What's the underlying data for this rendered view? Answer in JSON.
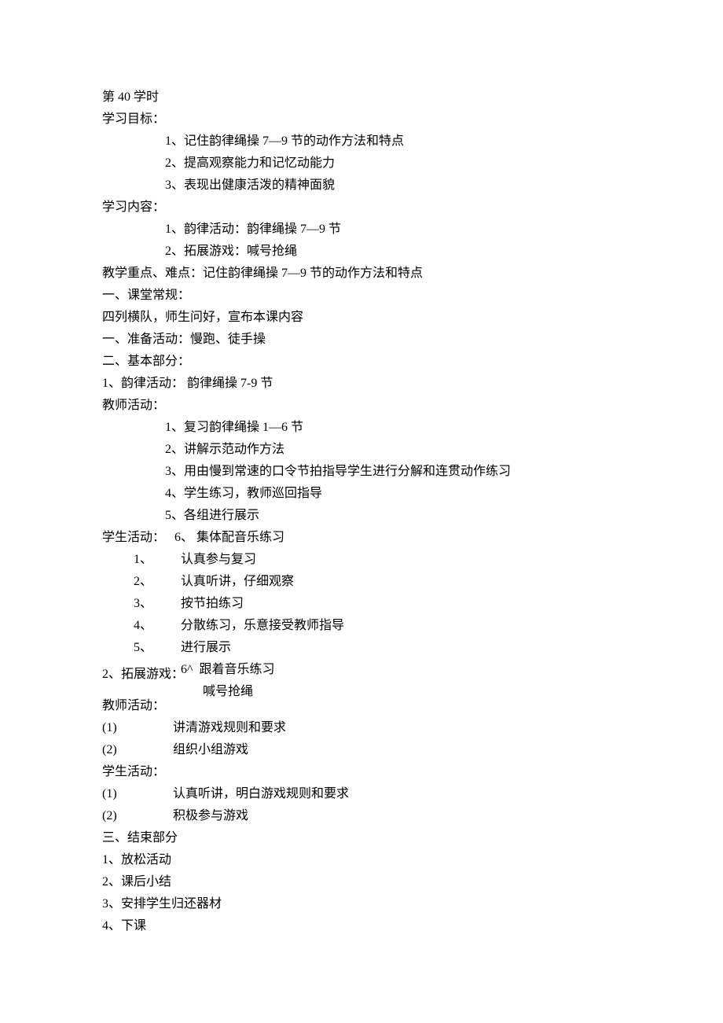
{
  "lesson": {
    "title": "第 40 学时",
    "objectives": {
      "heading": "学习目标：",
      "items": [
        "1、记住韵律绳操 7—9 节的动作方法和特点",
        "2、提高观察能力和记忆动能力",
        "3、表现出健康活泼的精神面貌"
      ]
    },
    "content": {
      "heading": "学习内容：",
      "items": [
        "1、韵律活动：韵律绳操 7—9 节",
        "2、拓展游戏：喊号抢绳"
      ]
    },
    "key_point": "教学重点、难点：记住韵律绳操 7—9 节的动作方法和特点",
    "routine": {
      "heading": "一、课堂常规：",
      "line": "四列横队，师生问好，宣布本课内容"
    },
    "prep": "一、准备活动：慢跑、徒手操",
    "main": {
      "heading": "二、基本部分：",
      "section1": {
        "title": "1、韵律活动： 韵律绳操 7-9 节",
        "teacher": {
          "heading": "教师活动：",
          "items": [
            "1、复习韵律绳操 1—6 节",
            "2、讲解示范动作方法",
            "3、用由慢到常速的口令节拍指导学生进行分解和连贯动作练习",
            "4、学生练习，教师巡回指导",
            "5、各组进行展示"
          ]
        },
        "student": {
          "heading_left": "学生活动：",
          "six_num": "6、",
          "six_text": "集体配音乐练习",
          "items": [
            {
              "num": "1、",
              "text": "认真参与复习"
            },
            {
              "num": "2、",
              "text": "认真听讲，仔细观察"
            },
            {
              "num": "3、",
              "text": "按节拍练习"
            },
            {
              "num": "4、",
              "text": "分散练习，乐意接受教师指导"
            },
            {
              "num": "5、",
              "text": "进行展示"
            }
          ]
        },
        "game": {
          "label": "2、拓展游戏：",
          "six_num": "6^",
          "six_text": "跟着音乐练习",
          "name": "喊号抢绳"
        },
        "teacher2": {
          "heading": "教师活动：",
          "items": [
            {
              "num": "(1)",
              "text": "讲清游戏规则和要求"
            },
            {
              "num": "(2)",
              "text": "组织小组游戏"
            }
          ]
        },
        "student2": {
          "heading": "学生活动：",
          "items": [
            {
              "num": "(1)",
              "text": "认真听讲，明白游戏规则和要求"
            },
            {
              "num": "(2)",
              "text": "积极参与游戏"
            }
          ]
        }
      }
    },
    "ending": {
      "heading": "三、结束部分",
      "items": [
        "1、放松活动",
        "2、课后小结",
        "3、安排学生归还器材",
        "4、下课"
      ]
    }
  }
}
